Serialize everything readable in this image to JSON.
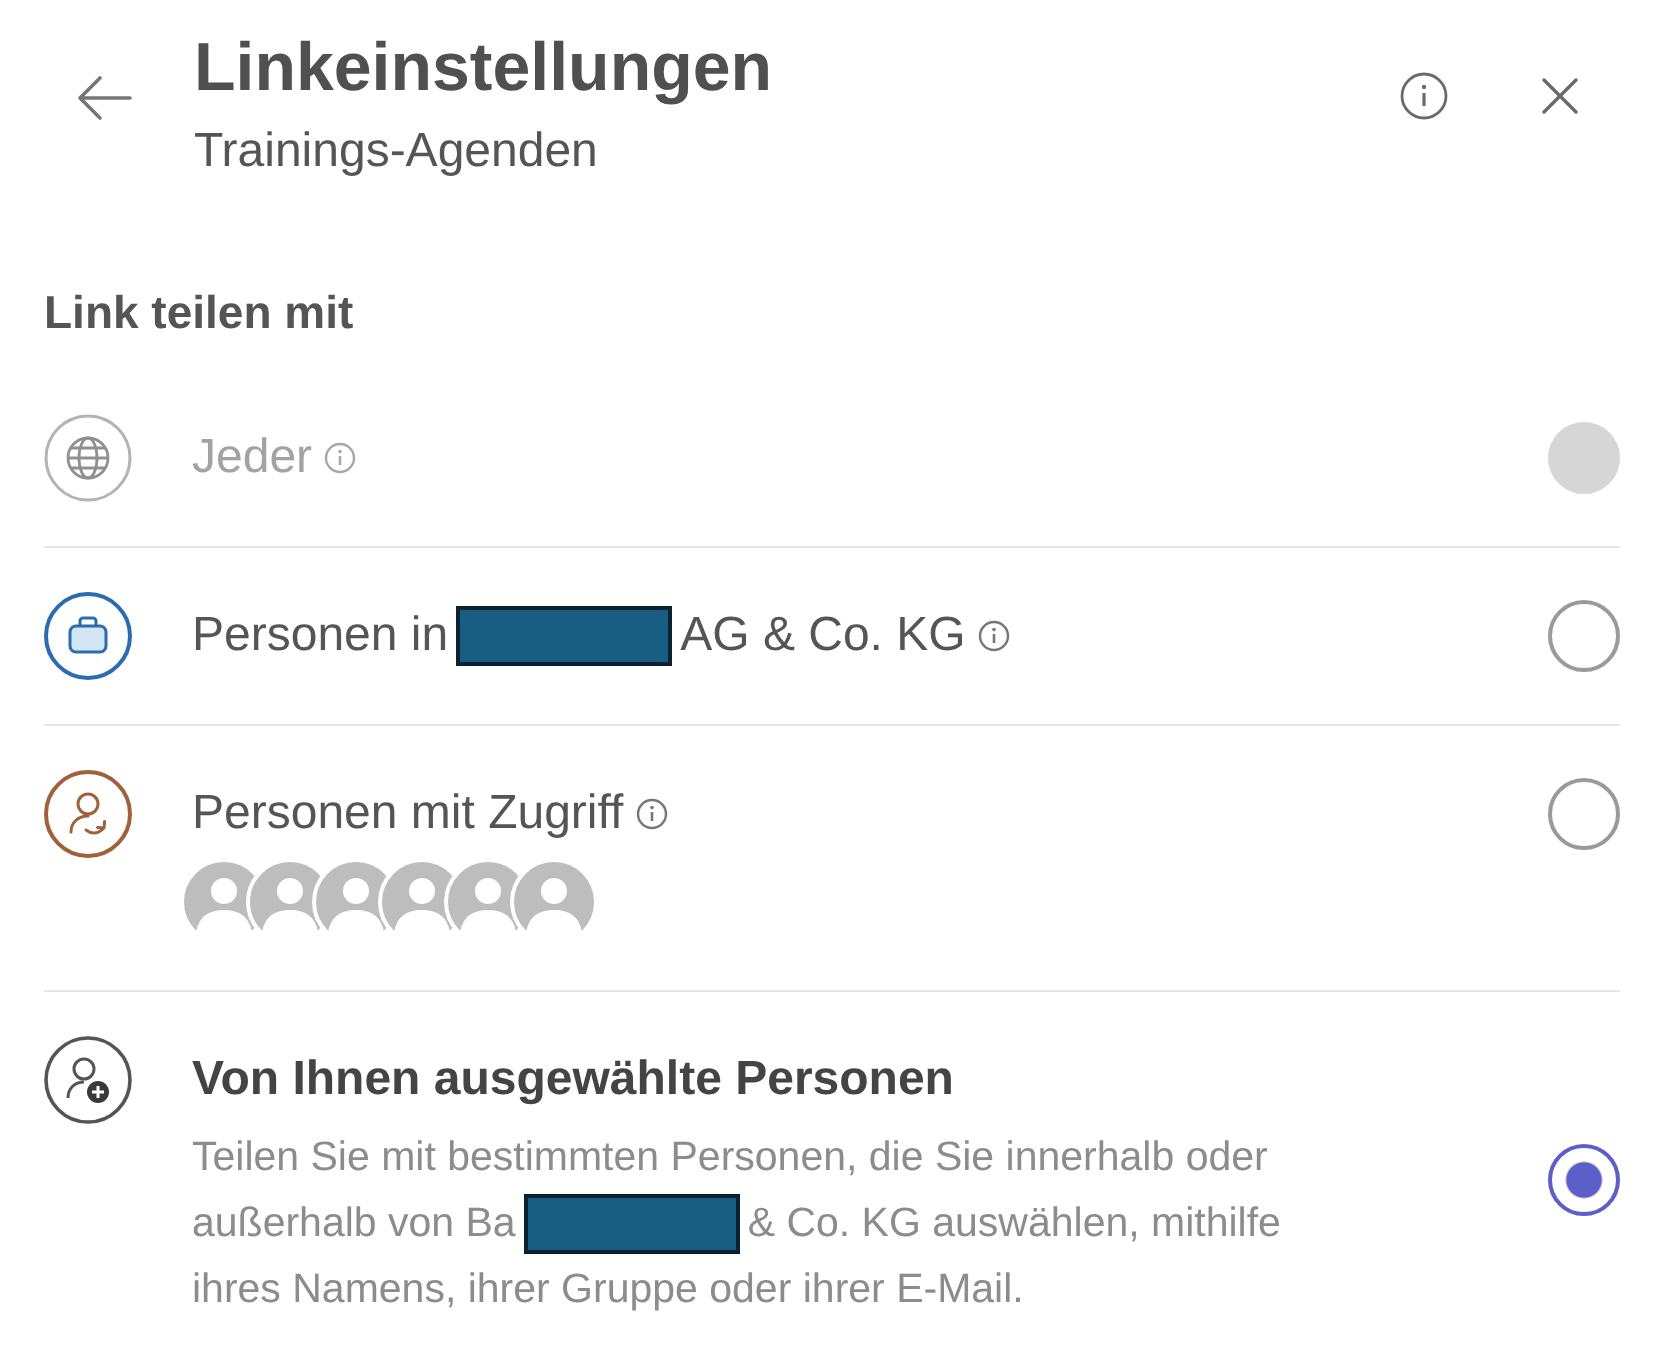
{
  "header": {
    "title": "Linkeinstellungen",
    "subtitle": "Trainings-Agenden"
  },
  "section_title": "Link teilen mit",
  "options": [
    {
      "label": [
        {
          "kind": "text",
          "text": "Jeder"
        }
      ],
      "info": true,
      "selected": false,
      "disabled": true
    },
    {
      "label": [
        {
          "kind": "text",
          "text": "Personen in"
        },
        {
          "kind": "redaction"
        },
        {
          "kind": "text",
          "text": "AG & Co. KG"
        }
      ],
      "info": true,
      "selected": false,
      "disabled": false
    },
    {
      "label": [
        {
          "kind": "text",
          "text": "Personen mit Zugriff"
        }
      ],
      "info": true,
      "avatars": [
        {
          "kind": "person"
        },
        {
          "kind": "person"
        },
        {
          "kind": "person"
        },
        {
          "kind": "person"
        },
        {
          "kind": "person"
        },
        {
          "kind": "person"
        }
      ],
      "selected": false,
      "disabled": false
    },
    {
      "label": [
        {
          "kind": "text",
          "text": "Von Ihnen ausgewählte Personen"
        }
      ],
      "info": false,
      "description": [
        {
          "segments": [
            {
              "kind": "text",
              "text": "Teilen Sie mit bestimmten Personen, die Sie innerhalb oder"
            }
          ]
        },
        {
          "segments": [
            {
              "kind": "text",
              "text": "außerhalb von Ba"
            },
            {
              "kind": "redaction"
            },
            {
              "kind": "text",
              "text": "& Co. KG auswählen, mithilfe"
            }
          ]
        },
        {
          "segments": [
            {
              "kind": "text",
              "text": "ihres Namens, ihrer Gruppe oder ihrer E-Mail."
            }
          ]
        }
      ],
      "selected": true,
      "disabled": false
    }
  ]
}
